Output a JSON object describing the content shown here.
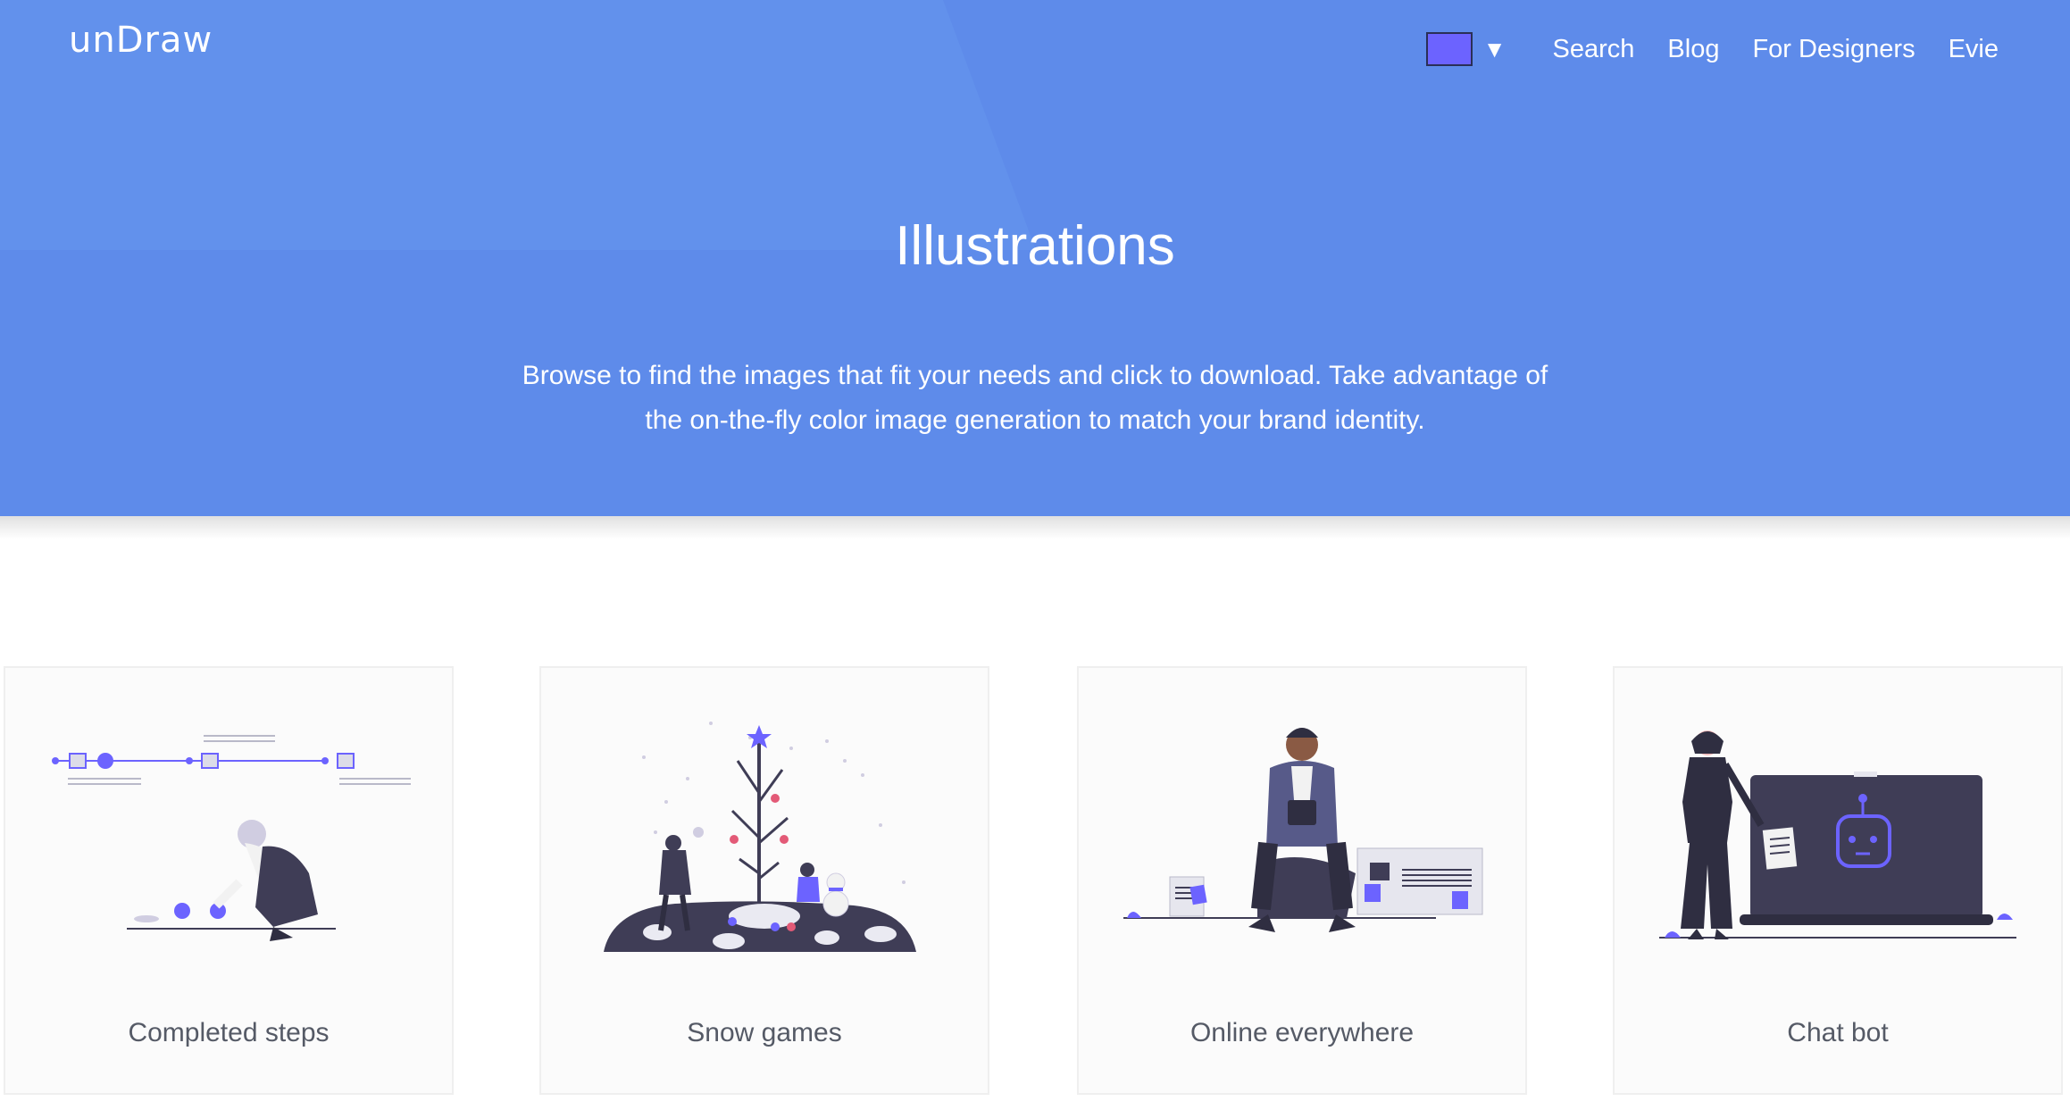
{
  "brand": {
    "logo": "unDraw",
    "accent_color": "#6c63ff",
    "hero_color": "#5e8bea"
  },
  "nav": {
    "color_picker": {
      "swatch_color": "#6c63ff",
      "caret": "▼"
    },
    "links": [
      "Search",
      "Blog",
      "For Designers",
      "Evie"
    ]
  },
  "hero": {
    "title": "Illustrations",
    "subtitle": "Browse to find the images that fit your needs and click to download. Take advantage of the on-the-fly color image generation to match your brand identity."
  },
  "illustrations": [
    {
      "label": "Completed steps",
      "icon": "completed-steps-illustration"
    },
    {
      "label": "Snow games",
      "icon": "snow-games-illustration"
    },
    {
      "label": "Online everywhere",
      "icon": "online-everywhere-illustration"
    },
    {
      "label": "Chat bot",
      "icon": "chat-bot-illustration"
    }
  ]
}
